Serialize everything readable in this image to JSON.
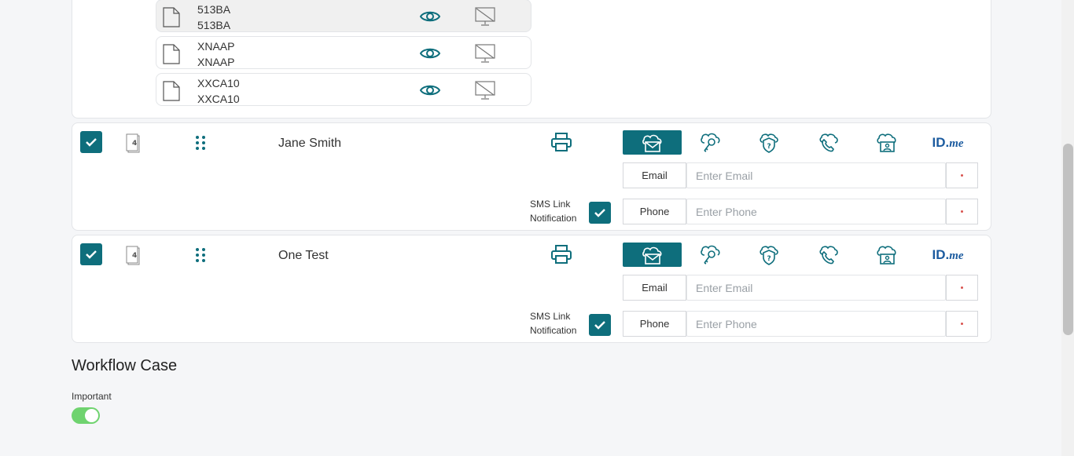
{
  "documents": [
    {
      "line1": "513BA",
      "line2": "513BA",
      "highlighted": true
    },
    {
      "line1": "XNAAP",
      "line2": "XNAAP",
      "highlighted": false
    },
    {
      "line1": "XXCA10",
      "line2": "XXCA10",
      "highlighted": false
    }
  ],
  "signers": [
    {
      "name": "Jane Smith",
      "page_count": "4",
      "checked": true,
      "email_label": "Email",
      "email_placeholder": "Enter Email",
      "phone_label": "Phone",
      "phone_placeholder": "Enter Phone",
      "sms_label_line1": "SMS Link",
      "sms_label_line2": "Notification",
      "sms_checked": true,
      "auth_methods": [
        "email-icon",
        "key-icon",
        "shield-question-icon",
        "phone-call-icon",
        "cloud-id-icon",
        "idme-logo"
      ],
      "active_method": "email-icon"
    },
    {
      "name": "One Test",
      "page_count": "4",
      "checked": true,
      "email_label": "Email",
      "email_placeholder": "Enter Email",
      "phone_label": "Phone",
      "phone_placeholder": "Enter Phone",
      "sms_label_line1": "SMS Link",
      "sms_label_line2": "Notification",
      "sms_checked": true,
      "auth_methods": [
        "email-icon",
        "key-icon",
        "shield-question-icon",
        "phone-call-icon",
        "cloud-id-icon",
        "idme-logo"
      ],
      "active_method": "email-icon"
    }
  ],
  "idme": {
    "id": "ID.",
    "me": "me"
  },
  "workflow": {
    "title": "Workflow Case",
    "important_label": "Important",
    "important_on": true
  },
  "colors": {
    "accent": "#0e6e7c",
    "toggle_on": "#6fd36f",
    "idme": "#1b5b9f"
  }
}
